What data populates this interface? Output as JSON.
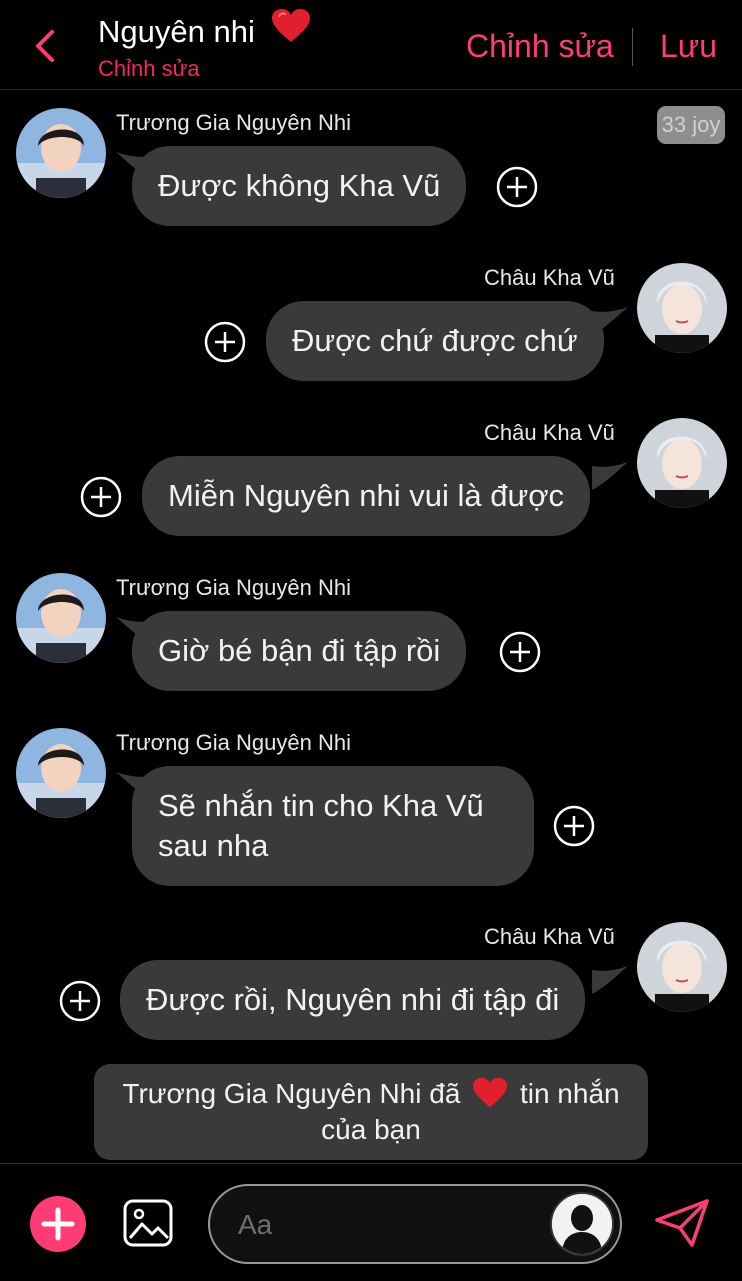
{
  "header": {
    "title": "Nguyên nhi",
    "subtitle": "Chỉnh sửa",
    "edit_label": "Chỉnh sửa",
    "save_label": "Lưu",
    "accent_color": "#ff3d74"
  },
  "time_badge": "33 joy",
  "messages": [
    {
      "sender": "Trương Gia Nguyên Nhi",
      "text": "Được không Kha Vũ",
      "side": "left"
    },
    {
      "sender": "Châu Kha Vũ",
      "text": "Được chứ được chứ",
      "side": "right"
    },
    {
      "sender": "Châu Kha Vũ",
      "text": "Miễn Nguyên nhi vui là được",
      "side": "right"
    },
    {
      "sender": "Trương Gia Nguyên Nhi",
      "text": "Giờ bé bận đi tập rồi",
      "side": "left"
    },
    {
      "sender": "Trương Gia Nguyên Nhi",
      "text_line1": "Sẽ nhắn tin cho Kha Vũ",
      "text_line2": "sau nha",
      "side": "left"
    },
    {
      "sender": "Châu Kha Vũ",
      "text": "Được rồi, Nguyên nhi đi tập đi",
      "side": "right"
    }
  ],
  "system_message": {
    "part1": "Trương Gia Nguyên Nhi đã",
    "part2": "tin nhắn",
    "line2": "của bạn",
    "icon": "heart-icon"
  },
  "composer": {
    "placeholder": "Aa",
    "icons": [
      "plus-icon",
      "image-icon",
      "avatar-silhouette-icon",
      "send-icon"
    ]
  }
}
